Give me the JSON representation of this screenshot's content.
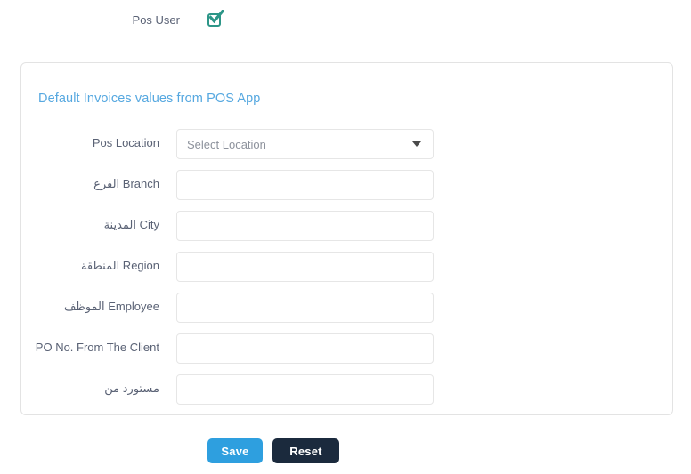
{
  "top": {
    "pos_user_label": "Pos User",
    "pos_user_checked": true,
    "checkbox_color": "#2d9688"
  },
  "card": {
    "title": "Default Invoices values from POS App",
    "title_color": "#56a8e0",
    "fields": [
      {
        "label": "Pos Location",
        "type": "select",
        "value": "",
        "placeholder": "Select Location",
        "name": "pos-location"
      },
      {
        "label": "الفرع Branch",
        "type": "text",
        "value": "",
        "placeholder": "",
        "name": "branch"
      },
      {
        "label": "المدينة City",
        "type": "text",
        "value": "",
        "placeholder": "",
        "name": "city"
      },
      {
        "label": "المنطقة Region",
        "type": "text",
        "value": "",
        "placeholder": "",
        "name": "region"
      },
      {
        "label": "الموظف Employee",
        "type": "text",
        "value": "",
        "placeholder": "",
        "name": "employee"
      },
      {
        "label": "PO No. From The Client",
        "type": "text",
        "value": "",
        "placeholder": "",
        "name": "po-no-from-the-client"
      },
      {
        "label": "مستورد من",
        "type": "text",
        "value": "",
        "placeholder": "",
        "name": "imported-from"
      }
    ]
  },
  "actions": {
    "save_label": "Save",
    "reset_label": "Reset",
    "save_color": "#2e9fdf",
    "reset_color": "#1b2a3d"
  }
}
